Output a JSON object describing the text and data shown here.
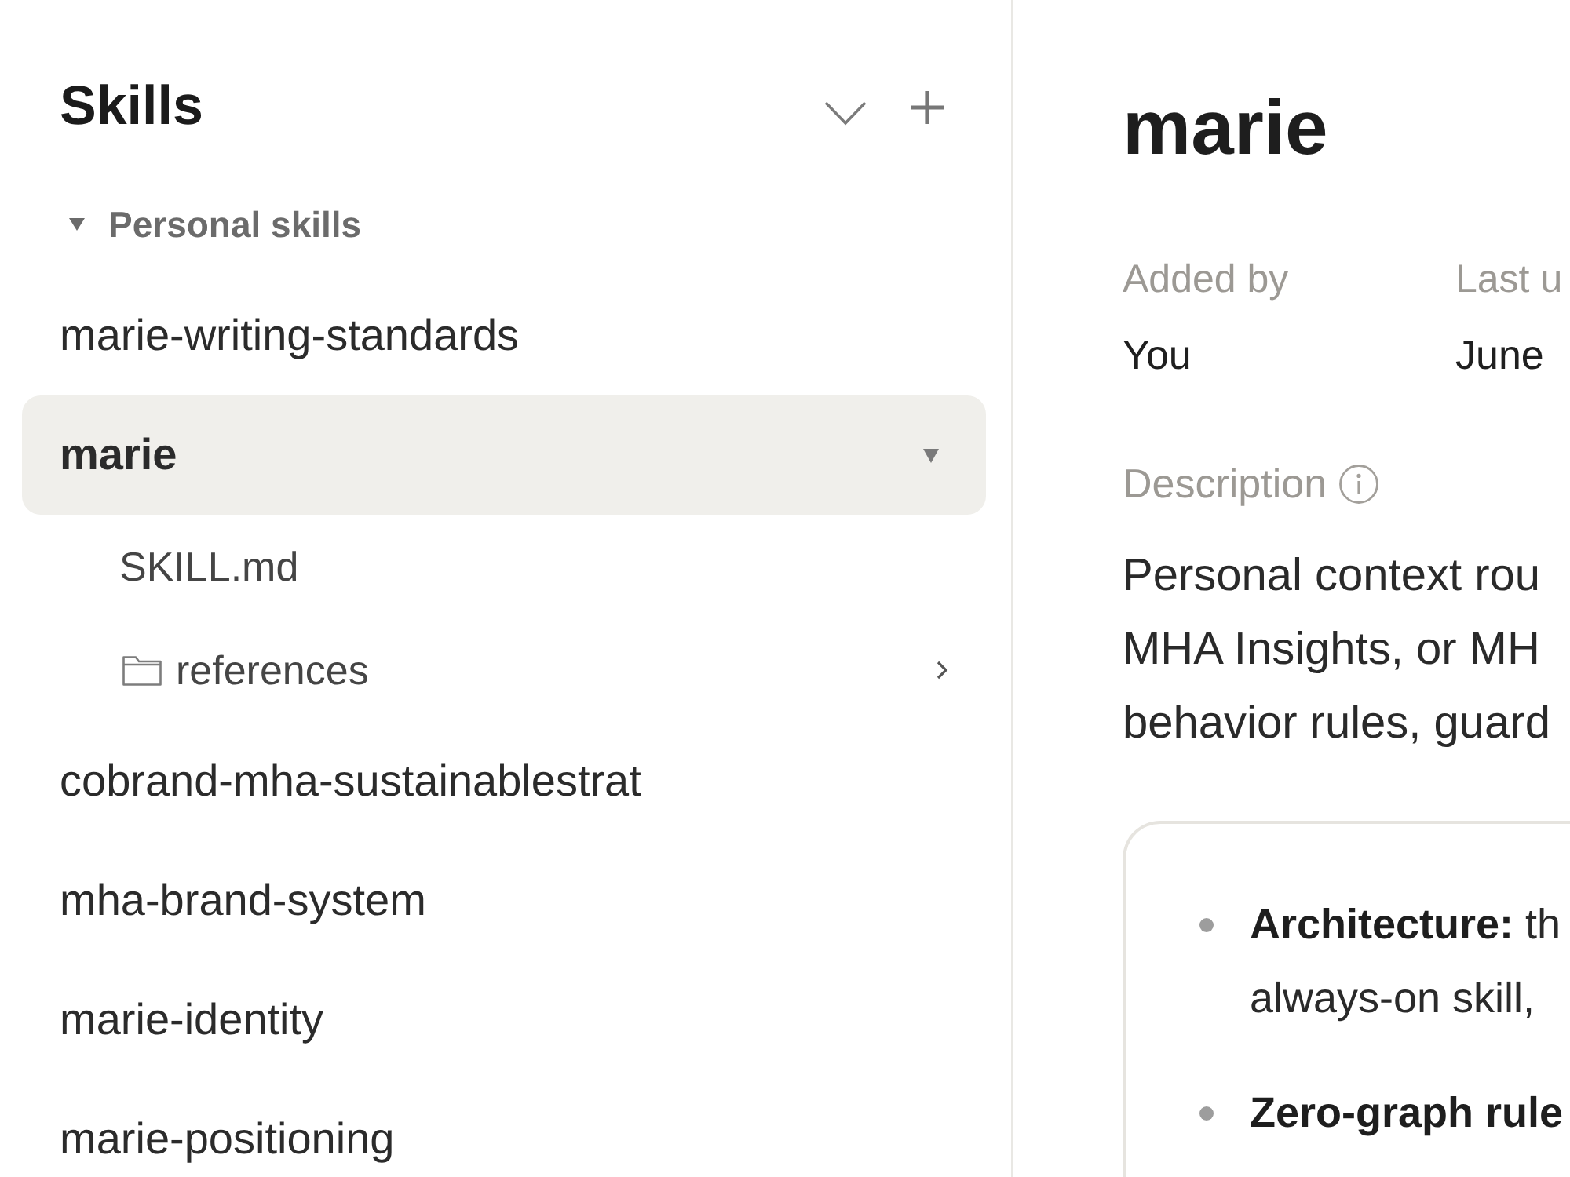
{
  "sidebar": {
    "title": "Skills",
    "section": {
      "label": "Personal skills",
      "expanded": true
    },
    "items": [
      {
        "name": "marie-writing-standards",
        "selected": false,
        "expanded": false
      },
      {
        "name": "marie",
        "selected": true,
        "expanded": true,
        "children": [
          {
            "kind": "file",
            "name": "SKILL.md"
          },
          {
            "kind": "folder",
            "name": "references",
            "expanded": false
          }
        ]
      },
      {
        "name": "cobrand-mha-sustainablestrat",
        "selected": false,
        "expanded": false
      },
      {
        "name": "mha-brand-system",
        "selected": false,
        "expanded": false
      },
      {
        "name": "marie-identity",
        "selected": false,
        "expanded": false
      },
      {
        "name": "marie-positioning",
        "selected": false,
        "expanded": false
      }
    ]
  },
  "detail": {
    "title": "marie",
    "meta": [
      {
        "label": "Added by",
        "value": "You"
      },
      {
        "label": "Last u",
        "value": "June"
      }
    ],
    "description": {
      "label": "Description",
      "lines": [
        "Personal context rou",
        "MHA Insights, or MH",
        "behavior rules, guard"
      ]
    },
    "highlights": [
      {
        "term": "Architecture:",
        "lines": [
          "th",
          "always-on skill,"
        ]
      },
      {
        "term": "Zero-graph rule"
      }
    ]
  }
}
